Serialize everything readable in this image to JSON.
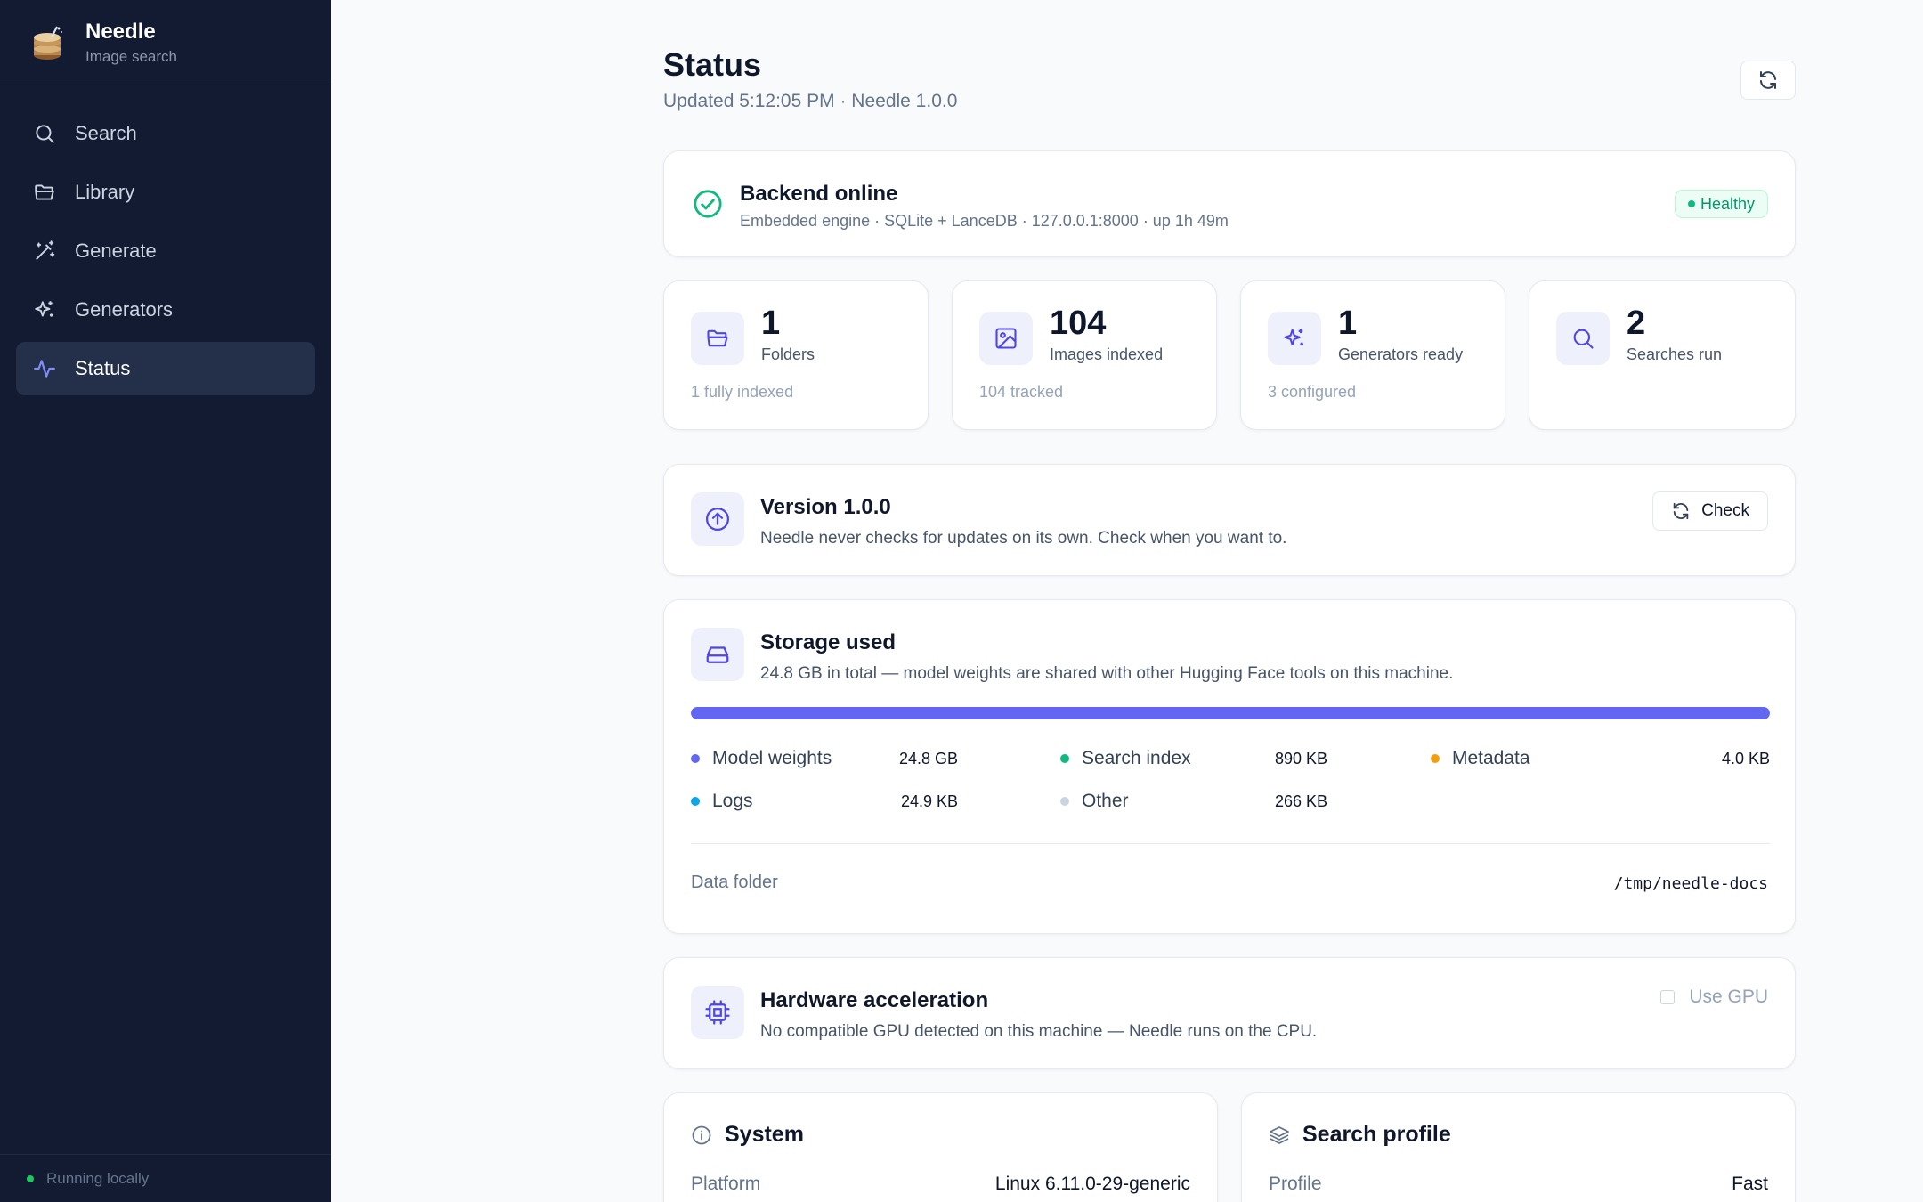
{
  "app": {
    "name": "Needle",
    "subtitle": "Image search"
  },
  "sidebar": {
    "items": [
      {
        "label": "Search",
        "icon": "search-icon"
      },
      {
        "label": "Library",
        "icon": "folder-icon"
      },
      {
        "label": "Generate",
        "icon": "wand-icon"
      },
      {
        "label": "Generators",
        "icon": "sparkles-icon"
      },
      {
        "label": "Status",
        "icon": "activity-icon",
        "active": true
      }
    ],
    "footer": "Running locally"
  },
  "header": {
    "title": "Status",
    "updated": "Updated 5:12:05 PM · Needle 1.0.0"
  },
  "backend": {
    "title": "Backend online",
    "detail": "Embedded engine · SQLite + LanceDB · 127.0.0.1:8000 · up 1h 49m",
    "badge": "Healthy"
  },
  "stats": [
    {
      "value": "1",
      "label": "Folders",
      "footnote": "1 fully indexed",
      "icon": "folder-icon"
    },
    {
      "value": "104",
      "label": "Images indexed",
      "footnote": "104 tracked",
      "icon": "image-icon"
    },
    {
      "value": "1",
      "label": "Generators ready",
      "footnote": "3 configured",
      "icon": "sparkles-icon"
    },
    {
      "value": "2",
      "label": "Searches run",
      "footnote": "",
      "icon": "search-icon"
    }
  ],
  "version": {
    "title": "Version 1.0.0",
    "desc": "Needle never checks for updates on its own. Check when you want to.",
    "button": "Check"
  },
  "storage": {
    "title": "Storage used",
    "desc": "24.8 GB in total — model weights are shared with other Hugging Face tools on this machine.",
    "used_fraction": 1.0,
    "legend": [
      {
        "name": "Model weights",
        "value": "24.8 GB",
        "color": "#6366f1"
      },
      {
        "name": "Search index",
        "value": "890 KB",
        "color": "#10b981"
      },
      {
        "name": "Metadata",
        "value": "4.0 KB",
        "color": "#f59e0b"
      },
      {
        "name": "Logs",
        "value": "24.9 KB",
        "color": "#0ea5e9"
      },
      {
        "name": "Other",
        "value": "266 KB",
        "color": "#cbd5e1"
      }
    ],
    "folder_label": "Data folder",
    "folder_path": "/tmp/needle-docs"
  },
  "hardware": {
    "title": "Hardware acceleration",
    "desc": "No compatible GPU detected on this machine — Needle runs on the CPU.",
    "gpu_label": "Use GPU"
  },
  "system": {
    "title": "System",
    "rows": [
      {
        "key": "Platform",
        "value": "Linux 6.11.0-29-generic"
      }
    ]
  },
  "search_profile": {
    "title": "Search profile",
    "rows": [
      {
        "key": "Profile",
        "value": "Fast"
      }
    ]
  }
}
